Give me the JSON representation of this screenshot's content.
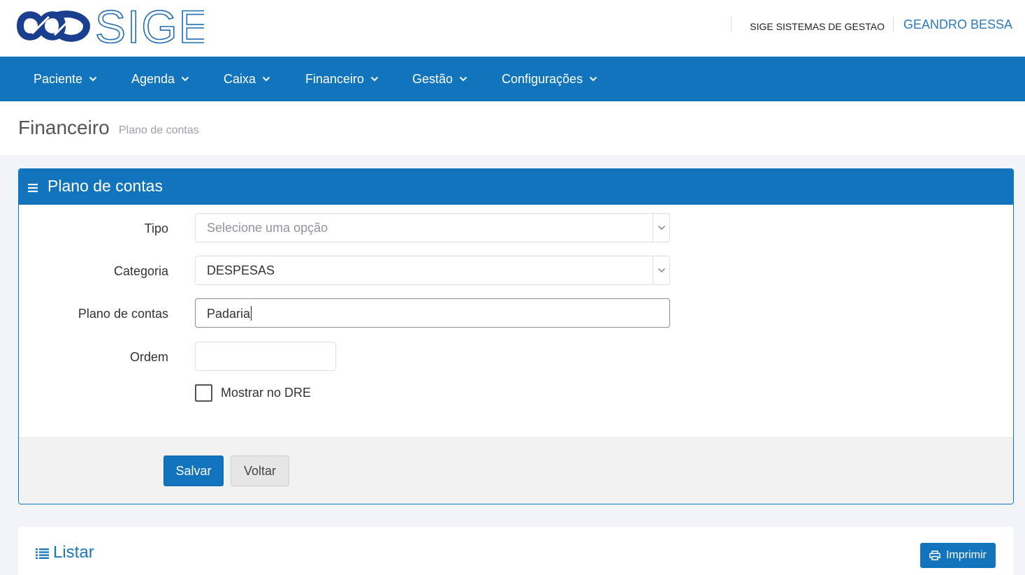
{
  "header": {
    "logo_text": "SIGE",
    "company": "SIGE SISTEMAS DE GESTAO",
    "user": "GEANDRO BESSA"
  },
  "nav": [
    {
      "label": "Paciente"
    },
    {
      "label": "Agenda"
    },
    {
      "label": "Caixa"
    },
    {
      "label": "Financeiro"
    },
    {
      "label": "Gestão"
    },
    {
      "label": "Configurações"
    }
  ],
  "page": {
    "title": "Financeiro",
    "subtitle": "Plano de contas"
  },
  "form": {
    "panel_title": "Plano de contas",
    "tipo": {
      "label": "Tipo",
      "placeholder": "Selecione uma opção"
    },
    "categoria": {
      "label": "Categoria",
      "value": "DESPESAS"
    },
    "plano": {
      "label": "Plano de contas",
      "value": "Padaria"
    },
    "ordem": {
      "label": "Ordem",
      "value": ""
    },
    "dre": {
      "label": "Mostrar no DRE",
      "checked": false
    },
    "save_label": "Salvar",
    "back_label": "Voltar"
  },
  "list": {
    "title": "Listar",
    "print_label": "Imprimir"
  },
  "colors": {
    "primary": "#1174bd",
    "logo_dark": "#1b3f8f",
    "logo_light": "#1f9ad6"
  }
}
